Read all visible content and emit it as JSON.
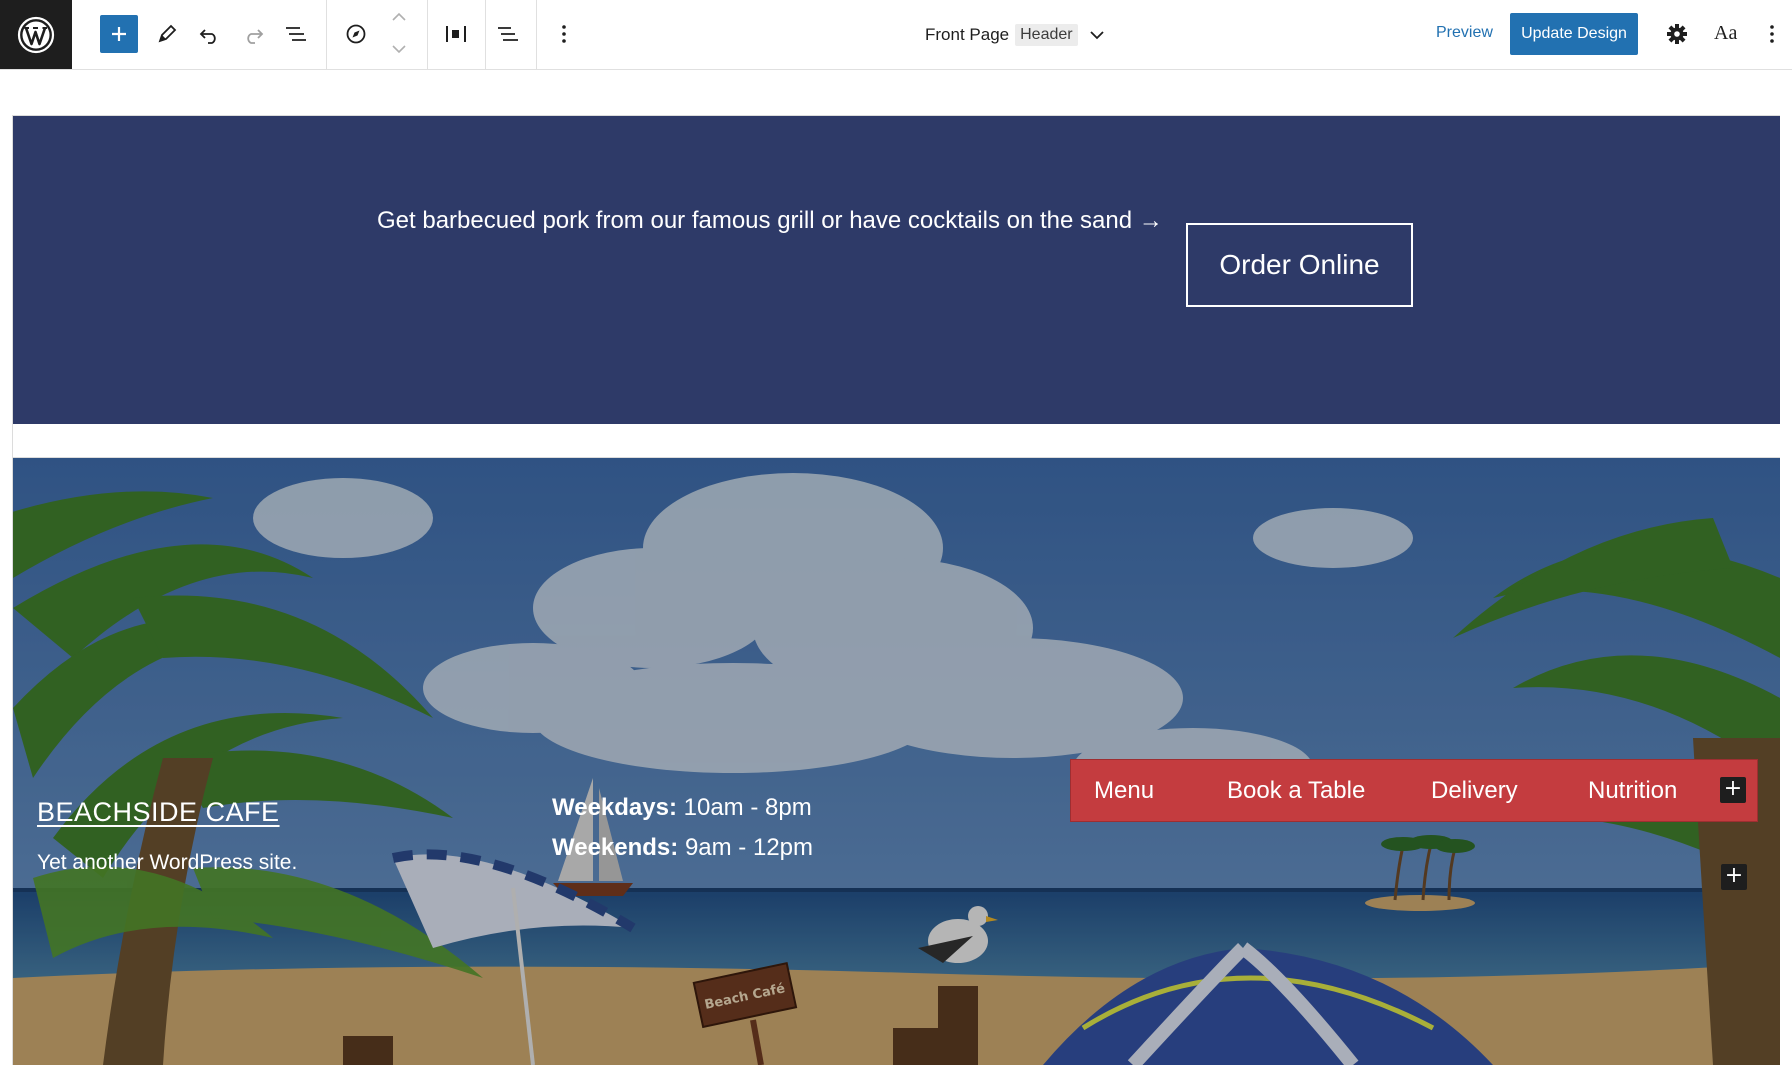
{
  "toolbar": {
    "document_title": "Front Page",
    "document_badge": "Header",
    "preview_label": "Preview",
    "update_label": "Update Design",
    "typography_label": "Aa",
    "icons": [
      "wordpress-logo-icon",
      "plus-icon",
      "pencil-icon",
      "undo-icon",
      "redo-icon",
      "list-view-icon",
      "navigation-icon",
      "chevron-up-icon",
      "chevron-down-icon",
      "justify-icon",
      "align-icon",
      "more-options-icon",
      "gear-icon"
    ]
  },
  "banner": {
    "text": "Get barbecued pork from our famous grill or have cocktails on the sand →",
    "button_label": "Order Online",
    "background": "#2e3a68"
  },
  "hero": {
    "site_title": "BEACHSIDE CAFE",
    "tagline": "Yet another WordPress site.",
    "hours": [
      {
        "label": "Weekdays:",
        "value": "10am - 8pm"
      },
      {
        "label": "Weekends:",
        "value": "9am - 12pm"
      }
    ],
    "nav": {
      "items": [
        "Menu",
        "Book a Table",
        "Delivery",
        "Nutrition"
      ],
      "background": "#c43c3f",
      "add_label": "+"
    },
    "add_block_label": "+",
    "sign_text": "Beach Café"
  },
  "colors": {
    "accent": "#2271b1",
    "toolbar_dark": "#1e1e1e"
  }
}
